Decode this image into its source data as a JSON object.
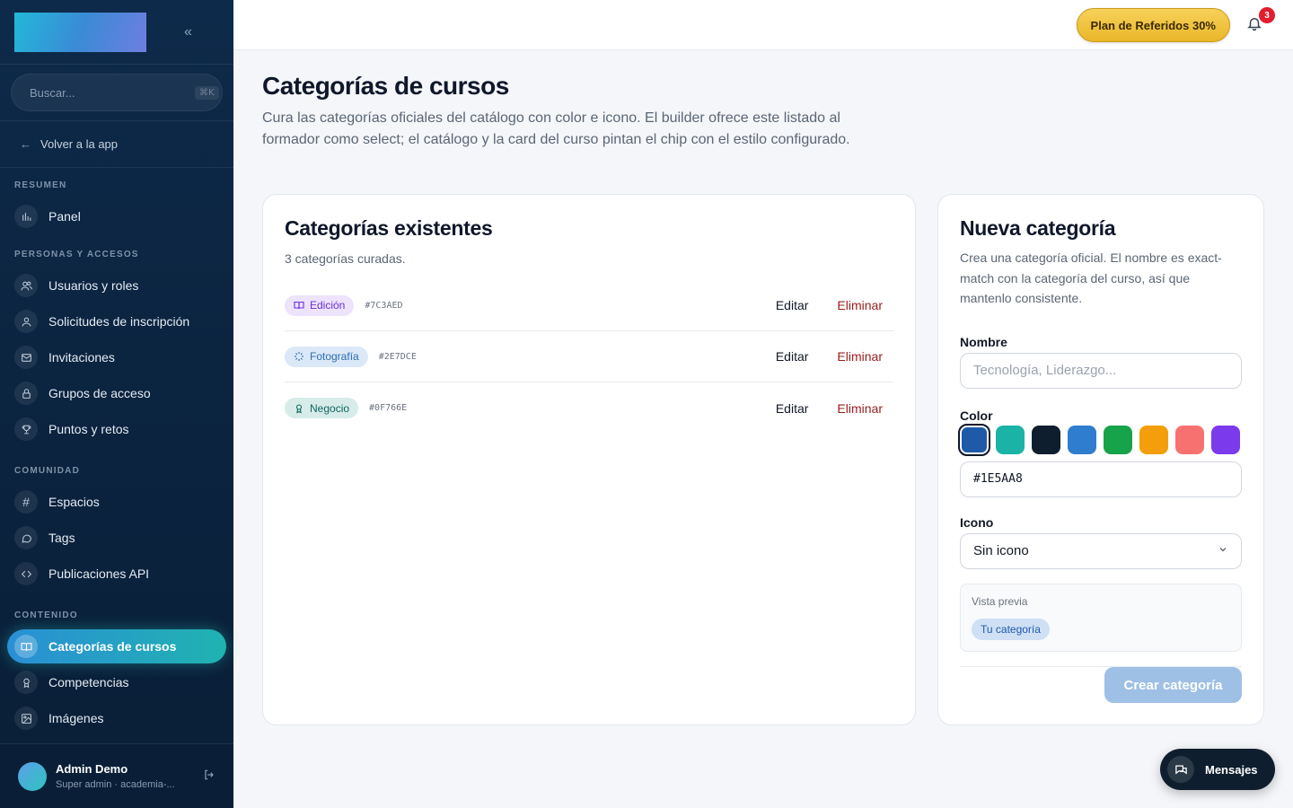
{
  "sidebar": {
    "search_placeholder": "Buscar...",
    "search_shortcut": "⌘K",
    "back_label": "Volver a la app",
    "sections": {
      "resumen": "RESUMEN",
      "personas": "PERSONAS Y ACCESOS",
      "comunidad": "COMUNIDAD",
      "contenido": "CONTENIDO"
    },
    "items": {
      "panel": "Panel",
      "usuarios": "Usuarios y roles",
      "solicitudes": "Solicitudes de inscripción",
      "invitaciones": "Invitaciones",
      "grupos": "Grupos de acceso",
      "puntos": "Puntos y retos",
      "espacios": "Espacios",
      "tags": "Tags",
      "publicaciones": "Publicaciones API",
      "categorias": "Categorías de cursos",
      "competencias": "Competencias",
      "imagenes": "Imágenes"
    },
    "user": {
      "name": "Admin Demo",
      "role": "Super admin · academia-..."
    }
  },
  "topbar": {
    "referral_label": "Plan de Referidos 30%",
    "notification_count": "3"
  },
  "page": {
    "title": "Categorías de cursos",
    "description": "Cura las categorías oficiales del catálogo con color e icono. El builder ofrece este listado al formador como select; el catálogo y la card del curso pintan el chip con el estilo configurado."
  },
  "existing": {
    "title": "Categorías existentes",
    "subtitle": "3 categorías curadas.",
    "edit_label": "Editar",
    "delete_label": "Eliminar",
    "categories": [
      {
        "name": "Edición",
        "hex": "#7C3AED",
        "icon": "book-icon",
        "bg": "#ede3fd",
        "fg": "#6d2fd6"
      },
      {
        "name": "Fotografía",
        "hex": "#2E7DCE",
        "icon": "loader-icon",
        "bg": "#dbe8f7",
        "fg": "#2a6cb3"
      },
      {
        "name": "Negocio",
        "hex": "#0F766E",
        "icon": "award-icon",
        "bg": "#d7ece9",
        "fg": "#0f665f"
      }
    ]
  },
  "new_category": {
    "title": "Nueva categoría",
    "description": "Crea una categoría oficial. El nombre es exact-match con la categoría del curso, así que mantenlo consistente.",
    "name_label": "Nombre",
    "name_placeholder": "Tecnología, Liderazgo...",
    "color_label": "Color",
    "swatches": [
      "#1E5AA8",
      "#1AB3A6",
      "#0F1E2E",
      "#2E7DCE",
      "#16A34A",
      "#F59E0B",
      "#F87171",
      "#7C3AED"
    ],
    "selected_swatch": 0,
    "color_value": "#1E5AA8",
    "icon_label": "Icono",
    "icon_value": "Sin icono",
    "preview_label": "Vista previa",
    "preview_chip": "Tu categoría",
    "create_label": "Crear categoría"
  },
  "messages_label": "Mensajes"
}
